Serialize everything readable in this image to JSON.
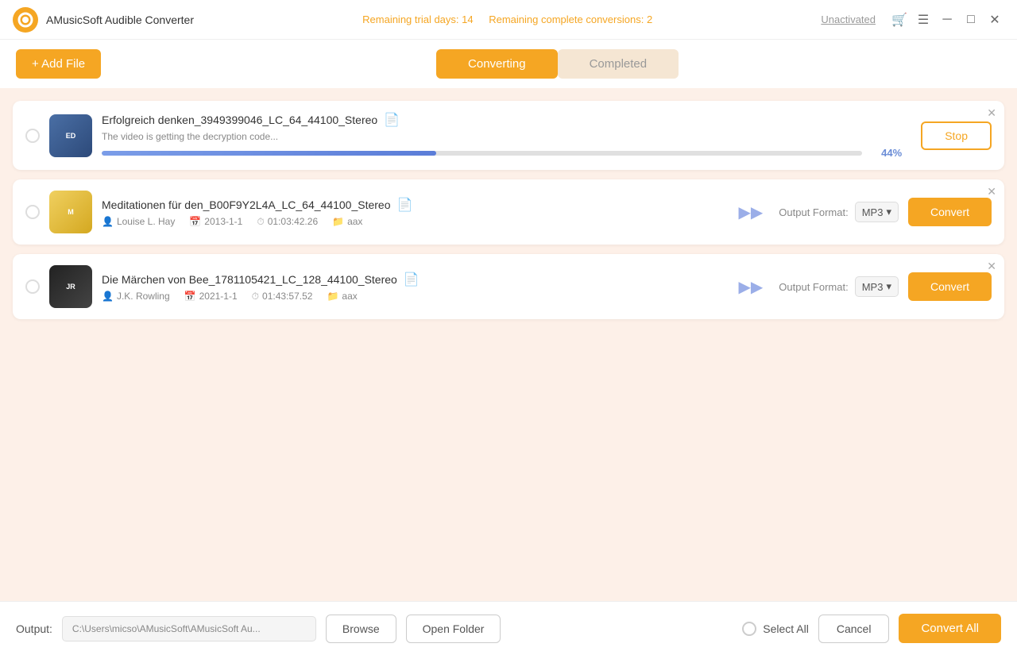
{
  "titlebar": {
    "logo_alt": "AMusicSoft logo",
    "app_title": "AMusicSoft Audible Converter",
    "trial_days_label": "Remaining trial days: 14",
    "trial_conversions_label": "Remaining complete conversions: 2",
    "unactivated_label": "Unactivated"
  },
  "toolbar": {
    "add_file_label": "+ Add File",
    "tab_converting": "Converting",
    "tab_completed": "Completed"
  },
  "files": [
    {
      "id": 1,
      "filename": "Erfolgreich denken_3949399046_LC_64_44100_Stereo",
      "status": "The video is getting the decryption code...",
      "progress": 44,
      "progress_label": "44%",
      "state": "converting",
      "thumb_type": "1",
      "thumb_label": "ED"
    },
    {
      "id": 2,
      "filename": "Meditationen für den_B00F9Y2L4A_LC_64_44100_Stereo",
      "author": "Louise L. Hay",
      "date": "2013-1-1",
      "duration": "01:03:42.26",
      "format": "aax",
      "output_format": "MP3",
      "state": "pending",
      "thumb_type": "2",
      "thumb_label": "M"
    },
    {
      "id": 3,
      "filename": "Die Märchen von Bee_1781105421_LC_128_44100_Stereo",
      "author": "J.K. Rowling",
      "date": "2021-1-1",
      "duration": "01:43:57.52",
      "format": "aax",
      "output_format": "MP3",
      "state": "pending",
      "thumb_type": "3",
      "thumb_label": "JR"
    }
  ],
  "bottom_bar": {
    "output_label": "Output:",
    "output_path": "C:\\Users\\micso\\AMusicSoft\\AMusicSoft Au...",
    "browse_label": "Browse",
    "open_folder_label": "Open Folder",
    "select_all_label": "Select All",
    "cancel_label": "Cancel",
    "convert_all_label": "Convert All"
  },
  "buttons": {
    "stop_label": "Stop",
    "convert_label": "Convert"
  }
}
